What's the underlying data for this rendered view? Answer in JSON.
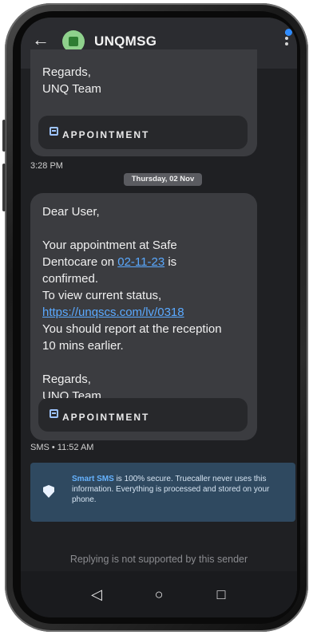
{
  "header": {
    "title": "UNQMSG",
    "back_icon": "arrow-left-icon",
    "avatar_icon": "business-icon",
    "menu_icon": "kebab-menu-icon",
    "notification_color": "#2f8cff"
  },
  "messages": [
    {
      "lines": [
        "Regards,",
        "UNQ Team"
      ],
      "button": "APPOINTMENT",
      "time": "3:28 PM"
    },
    {
      "date_separator": "Thursday, 02 Nov",
      "greeting": "Dear User,",
      "line1": "Your appointment at Safe",
      "line2_pre": "Dentocare on ",
      "date_link": "02-11-23",
      "line2_post": " is",
      "line3": "confirmed.",
      "line4": "To view current status,",
      "url": "https://unqscs.com/lv/0318",
      "line5": "You should report at the reception",
      "line6": "10 mins earlier.",
      "sign1": "Regards,",
      "sign2": "UNQ Team",
      "button": "APPOINTMENT",
      "time": "SMS • 11:52 AM"
    }
  ],
  "smart_sms": {
    "highlight": "Smart SMS",
    "text": " is 100% secure. Truecaller never uses this information. Everything is processed and stored on your phone."
  },
  "footer_note": "Replying is not supported by this sender",
  "nav": {
    "back": "◁",
    "home": "○",
    "recents": "□"
  }
}
